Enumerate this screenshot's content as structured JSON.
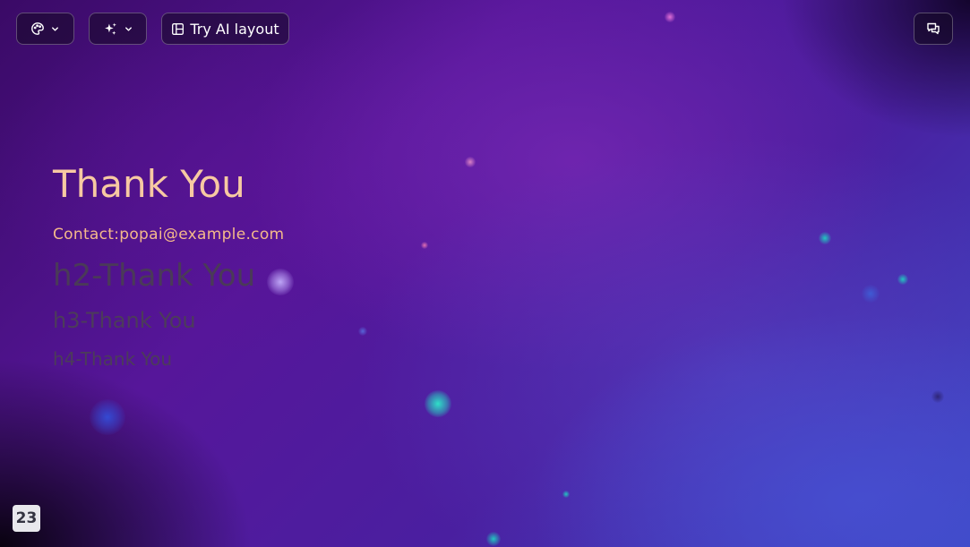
{
  "toolbar": {
    "theme_icon": "palette-icon",
    "theme_chevron": "chevron-down-icon",
    "magic_icon": "sparkles-icon",
    "magic_chevron": "chevron-down-icon",
    "ai_layout_icon": "layout-icon",
    "ai_layout_label": "Try AI layout",
    "comments_icon": "comments-icon"
  },
  "slide": {
    "title": "Thank You",
    "contact": "Contact:popai@example.com",
    "h2": "h2-Thank You",
    "h3": "h3-Thank You",
    "h4": "h4-Thank You",
    "page_number": "23"
  },
  "colors": {
    "title": "#f7c9a2",
    "contact": "#f4b98a",
    "subheading": "#4a3a58",
    "button_border": "#ffffff47",
    "page_badge_bg": "#e8e8ec"
  }
}
